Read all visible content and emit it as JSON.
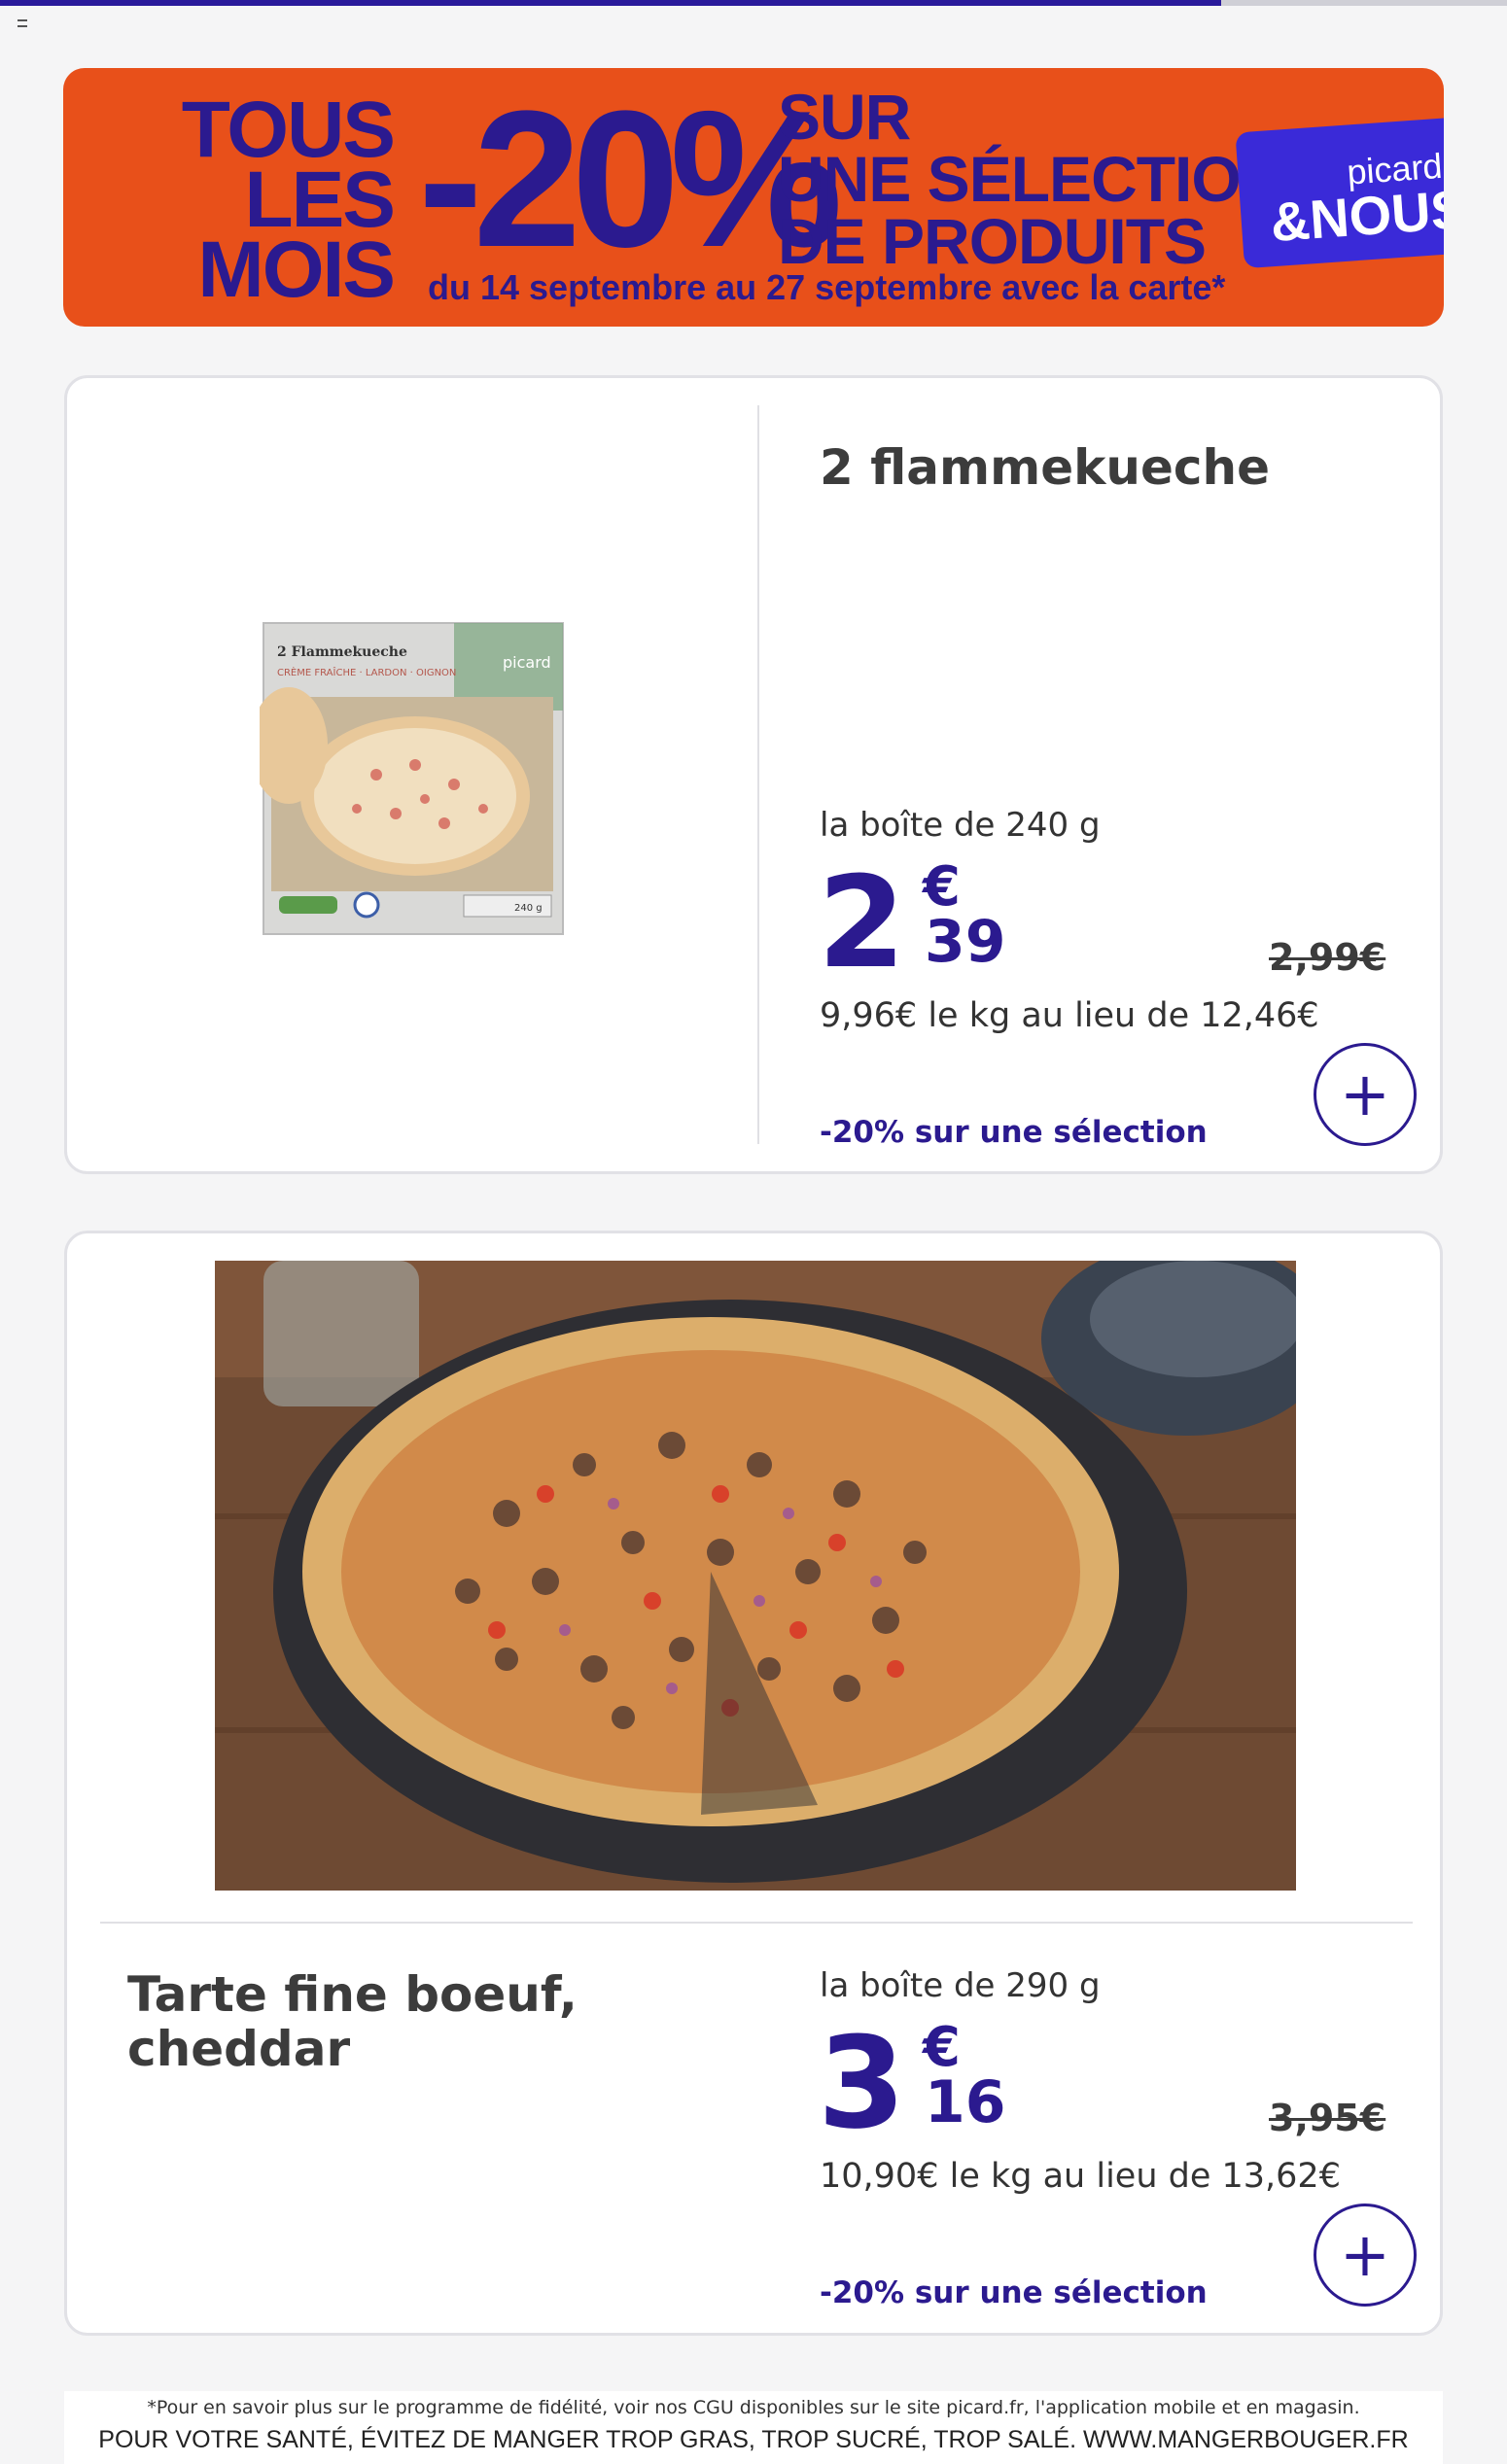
{
  "progress": {
    "fraction": 0.81,
    "track_color": "#cfcfd6",
    "fill_color": "#2a1a9b"
  },
  "banner": {
    "left_lines": [
      "TOUS",
      "LES",
      "MOIS"
    ],
    "big": "-20%",
    "right_lines": [
      "SUR",
      "UNE SÉLECTION",
      "DE PRODUITS"
    ],
    "dates": "du 14 septembre au 27 septembre avec la carte*",
    "card_brand": "picard",
    "card_name": "&NOUS",
    "background_color": "#e8501a",
    "text_color": "#2b1a8f"
  },
  "products": [
    {
      "name": "2 flammekueche",
      "image_icon": "flammekueche-box-image",
      "pack_size": "la boîte de 240 g",
      "price_int": "2",
      "price_currency": "€",
      "price_dec": "39",
      "old_price": "2,99€",
      "unit_price": "9,96€ le kg au lieu de 12,46€",
      "promo": "-20% sur une sélection",
      "add_label": "+",
      "box_label": "2 Flammekueche",
      "box_sub": "CRÈME FRAÎCHE · LARDON · OIGNON",
      "box_brand": "picard",
      "box_weight": "240 g"
    },
    {
      "name": "Tarte fine boeuf, cheddar",
      "image_icon": "tarte-fine-photo",
      "pack_size": "la boîte de 290 g",
      "price_int": "3",
      "price_currency": "€",
      "price_dec": "16",
      "old_price": "3,95€",
      "unit_price": "10,90€ le kg au lieu de 13,62€",
      "promo": "-20% sur une sélection",
      "add_label": "+"
    }
  ],
  "footer": {
    "legal": "*Pour en savoir plus sur le programme de fidélité, voir nos CGU disponibles sur le site picard.fr, l'application mobile et en magasin.",
    "health": "POUR VOTRE SANTÉ, ÉVITEZ DE MANGER TROP GRAS, TROP SUCRÉ, TROP SALÉ. WWW.MANGERBOUGER.FR"
  }
}
